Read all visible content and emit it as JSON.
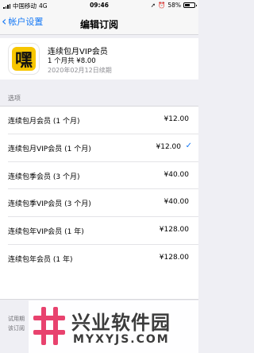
{
  "status_bar": {
    "carrier": "中国移动",
    "network": "4G",
    "time": "09:46",
    "battery": "58%"
  },
  "nav": {
    "back_label": "帐户设置",
    "title": "编辑订阅"
  },
  "subscription": {
    "name": "连续包月VIP会员",
    "price_line": "1 个月共 ¥8.00",
    "renewal": "2020年02月12日续期",
    "icon_glyph": "嘿"
  },
  "options_section": {
    "label": "选项"
  },
  "options": [
    {
      "name": "连续包月会员 (1 个月)",
      "price": "¥12.00",
      "selected": false
    },
    {
      "name": "连续包月VIP会员 (1 个月)",
      "price": "¥12.00",
      "selected": true
    },
    {
      "name": "连续包季会员 (3 个月)",
      "price": "¥40.00",
      "selected": false
    },
    {
      "name": "连续包季VIP会员 (3 个月)",
      "price": "¥40.00",
      "selected": false
    },
    {
      "name": "连续包年VIP会员 (1 年)",
      "price": "¥128.00",
      "selected": false
    },
    {
      "name": "连续包年会员 (1 年)",
      "price": "¥128.00",
      "selected": false
    }
  ],
  "trial": {
    "line1": "试用期",
    "line2": "该订阅"
  },
  "watermark": {
    "title": "兴业软件园",
    "url": "MYXYJS.COM"
  },
  "colors": {
    "accent": "#1478f5",
    "background": "#efeff4",
    "icon_yellow": "#f7c600",
    "watermark_pink": "#e8426e"
  }
}
